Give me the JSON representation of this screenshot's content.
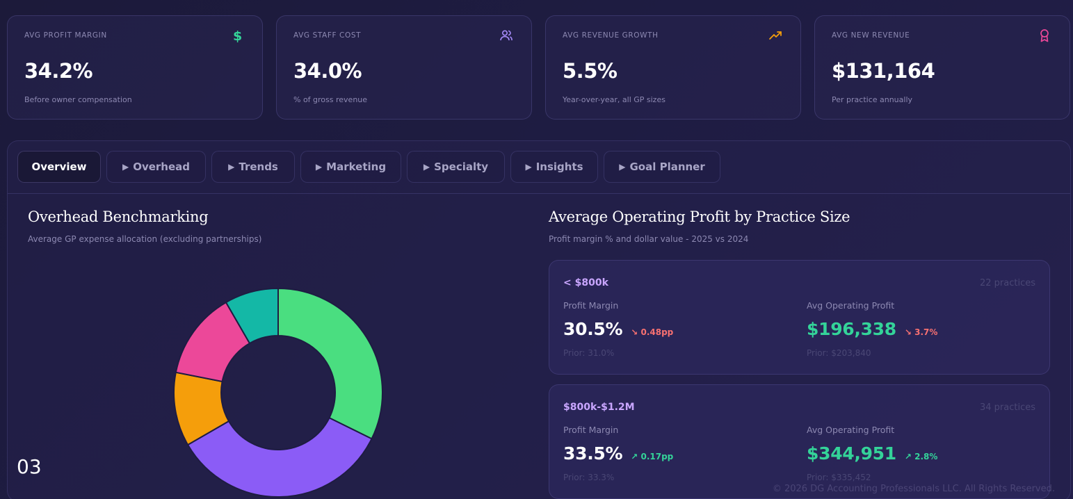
{
  "kpis": [
    {
      "label": "AVG PROFIT MARGIN",
      "value": "34.2%",
      "sub": "Before owner compensation",
      "icon": "dollar-icon",
      "icon_color": "#34d399"
    },
    {
      "label": "AVG STAFF COST",
      "value": "34.0%",
      "sub": "% of gross revenue",
      "icon": "users-icon",
      "icon_color": "#a78bfa"
    },
    {
      "label": "AVG REVENUE GROWTH",
      "value": "5.5%",
      "sub": "Year-over-year, all GP sizes",
      "icon": "trending-up-icon",
      "icon_color": "#f59e0b"
    },
    {
      "label": "AVG NEW REVENUE",
      "value": "$131,164",
      "sub": "Per practice annually",
      "icon": "award-icon",
      "icon_color": "#ec4899"
    }
  ],
  "tabs": [
    {
      "label": "Overview",
      "active": true
    },
    {
      "label": "Overhead",
      "active": false
    },
    {
      "label": "Trends",
      "active": false
    },
    {
      "label": "Marketing",
      "active": false
    },
    {
      "label": "Specialty",
      "active": false
    },
    {
      "label": "Insights",
      "active": false
    },
    {
      "label": "Goal Planner",
      "active": false
    }
  ],
  "overhead": {
    "title": "Overhead Benchmarking",
    "subtitle": "Average GP expense allocation (excluding partnerships)"
  },
  "chart_data": {
    "type": "pie",
    "donut": true,
    "slices": [
      {
        "value": 31,
        "color": "#4ade80"
      },
      {
        "value": 33,
        "color": "#8b5cf6"
      },
      {
        "value": 11,
        "color": "#f59e0b"
      },
      {
        "value": 13,
        "color": "#ec4899"
      },
      {
        "value": 8,
        "color": "#14b8a6"
      }
    ]
  },
  "operating_profit": {
    "title": "Average Operating Profit by Practice Size",
    "subtitle": "Profit margin % and dollar value - 2025 vs 2024",
    "margin_label": "Profit Margin",
    "profit_label": "Avg Operating Profit",
    "sizes": [
      {
        "name": "< $800k",
        "count": "22 practices",
        "margin": "30.5%",
        "margin_delta": "↘ 0.48pp",
        "margin_prior": "Prior: 31.0%",
        "profit": "$196,338",
        "profit_delta": "↘ 3.7%",
        "profit_prior": "Prior: $203,840",
        "direction": "down"
      },
      {
        "name": "$800k-$1.2M",
        "count": "34 practices",
        "margin": "33.5%",
        "margin_delta": "↗ 0.17pp",
        "margin_prior": "Prior: 33.3%",
        "profit": "$344,951",
        "profit_delta": "↗ 2.8%",
        "profit_prior": "Prior: $335,452",
        "direction": "up"
      }
    ]
  },
  "colors": {
    "profit_green": "#34d399",
    "delta_up": "#34d399",
    "delta_down": "#f87171",
    "size_name": "#c9a6ff"
  },
  "footer": {
    "page_number": "03",
    "copyright": "© 2026 DG Accounting Professionals LLC. All Rights Reserved."
  }
}
